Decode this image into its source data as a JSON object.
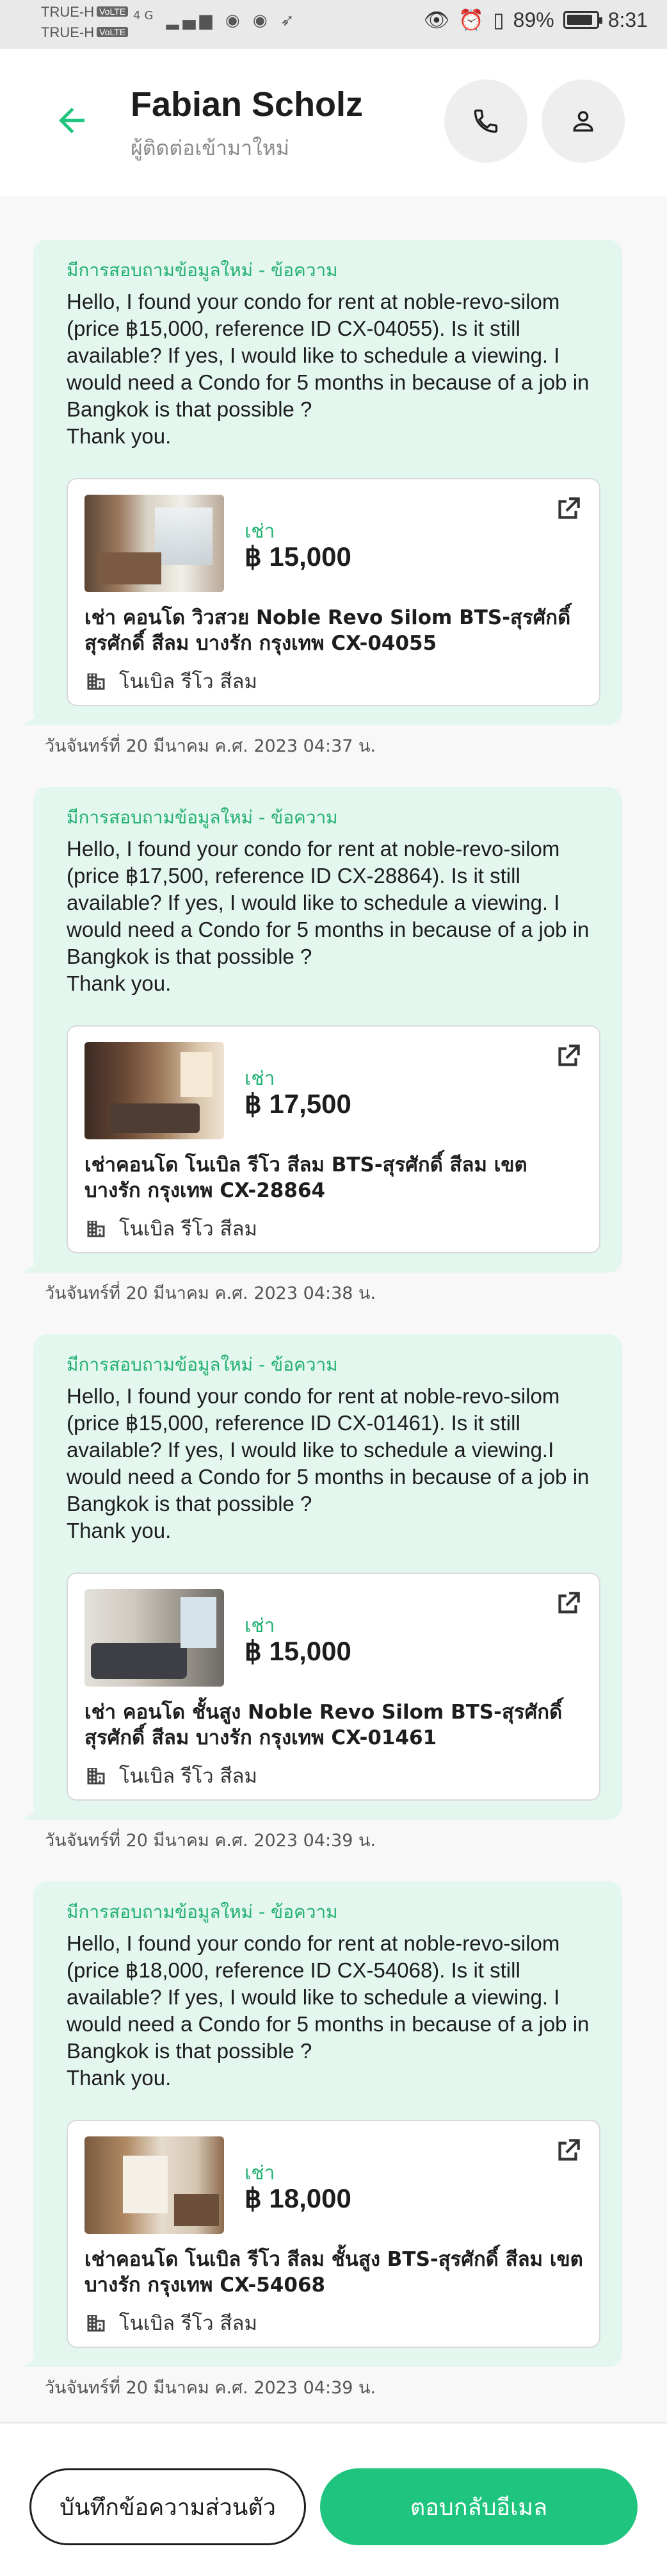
{
  "status_bar": {
    "carrier1": "TRUE-H",
    "carrier2": "TRUE-H",
    "volte": "VoLTE",
    "network": "4G",
    "battery": "89%",
    "battery_level": 0.89,
    "time": "8:31"
  },
  "header": {
    "name": "Fabian Scholz",
    "subtitle": "ผู้ติดต่อเข้ามาใหม่",
    "back_icon": "arrow-left-icon",
    "phone_icon": "phone-icon",
    "profile_icon": "person-icon"
  },
  "messages": [
    {
      "title": "มีการสอบถามข้อมูลใหม่ - ข้อความ",
      "body": "Hello, I found your condo for rent at noble-revo-silom (price ฿15,000, reference ID CX-04055). Is it still available? If yes, I would like to schedule a viewing. I would need a Condo for 5 months in because of a job in Bangkok is that possible ?\nThank you.",
      "rent_label": "เช่า",
      "price": "฿ 15,000",
      "listing_title": "เช่า คอนโด วิวสวย Noble Revo Silom BTS-สุรศักดิ์ สุรศักดิ์ สีลม บางรัก กรุงเทพ CX-04055",
      "project": "โนเบิล รีโว สีลม",
      "timestamp": "วันจันทร์ที่ 20 มีนาคม ค.ศ. 2023 04:37 น."
    },
    {
      "title": "มีการสอบถามข้อมูลใหม่ - ข้อความ",
      "body": "Hello, I found your condo for rent at noble-revo-silom (price ฿17,500, reference ID CX-28864). Is it still available? If yes, I would like to schedule a viewing. I would need a Condo for 5 months in because of a job in Bangkok is that possible ?\nThank you.",
      "rent_label": "เช่า",
      "price": "฿ 17,500",
      "listing_title": "เช่าคอนโด โนเบิล รีโว สีลม BTS-สุรศักดิ์ สีลม เขต บางรัก กรุงเทพ CX-28864",
      "project": "โนเบิล รีโว สีลม",
      "timestamp": "วันจันทร์ที่ 20 มีนาคม ค.ศ. 2023 04:38 น."
    },
    {
      "title": "มีการสอบถามข้อมูลใหม่ - ข้อความ",
      "body": "Hello, I found your condo for rent at noble-revo-silom (price ฿15,000, reference ID CX-01461). Is it still available? If yes, I would like to schedule a viewing.I would need a Condo for 5 months in because of a job in Bangkok is that possible ?\nThank you.",
      "rent_label": "เช่า",
      "price": "฿ 15,000",
      "listing_title": "เช่า คอนโด ชั้นสูง Noble Revo Silom BTS-สุรศักดิ์ สุรศักดิ์ สีลม บางรัก กรุงเทพ CX-01461",
      "project": "โนเบิล รีโว สีลม",
      "timestamp": "วันจันทร์ที่ 20 มีนาคม ค.ศ. 2023 04:39 น."
    },
    {
      "title": "มีการสอบถามข้อมูลใหม่ - ข้อความ",
      "body": "Hello, I found your condo for rent at noble-revo-silom (price ฿18,000, reference ID CX-54068). Is it still available? If yes, I would like to schedule a viewing. I would need a Condo for 5 months in because of a job in Bangkok is that possible ?\nThank you.",
      "rent_label": "เช่า",
      "price": "฿ 18,000",
      "listing_title": "เช่าคอนโด โนเบิล รีโว สีลม ชั้นสูง BTS-สุรศักดิ์ สีลม เขต บางรัก กรุงเทพ CX-54068",
      "project": "โนเบิล รีโว สีลม",
      "timestamp": "วันจันทร์ที่ 20 มีนาคม ค.ศ. 2023 04:39 น."
    }
  ],
  "footer": {
    "note_button": "บันทึกข้อความส่วนตัว",
    "reply_button": "ตอบกลับอีเมล"
  },
  "colors": {
    "accent": "#1fc57e",
    "bubble": "#e3f7ee",
    "title_green": "#22b071"
  }
}
